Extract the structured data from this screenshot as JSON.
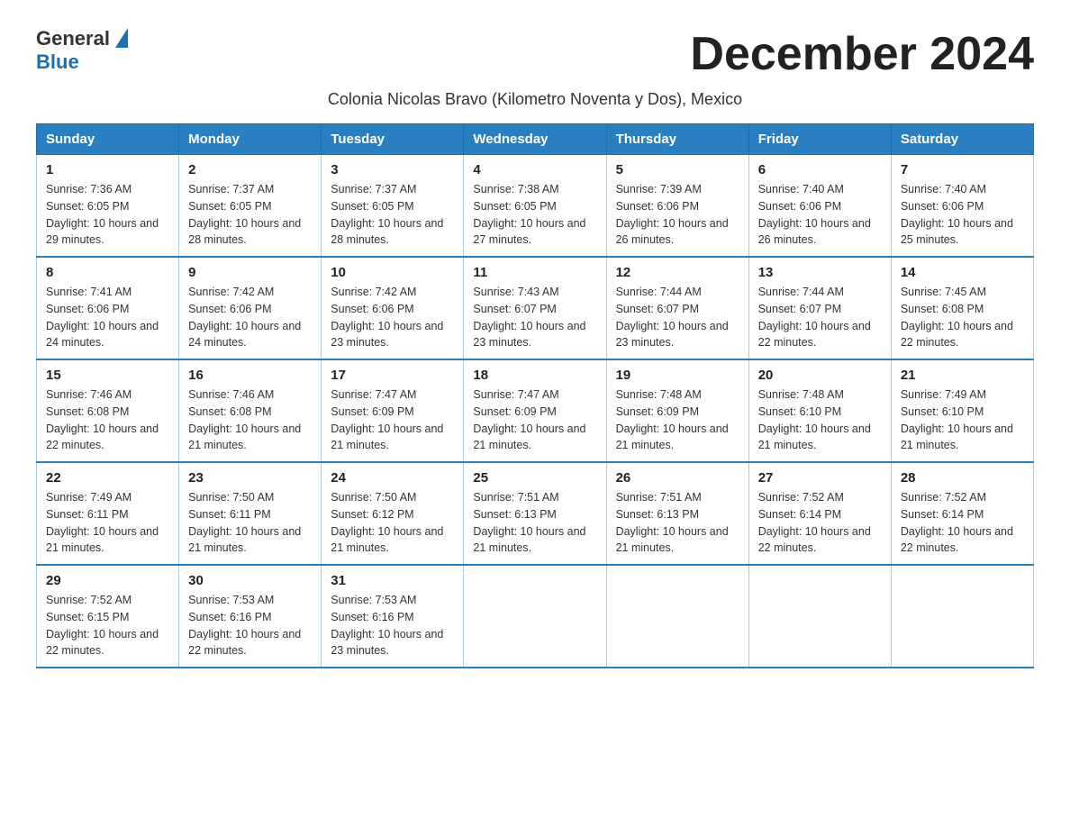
{
  "header": {
    "logo_general": "General",
    "logo_blue": "Blue",
    "month_title": "December 2024",
    "subtitle": "Colonia Nicolas Bravo (Kilometro Noventa y Dos), Mexico"
  },
  "days_of_week": [
    "Sunday",
    "Monday",
    "Tuesday",
    "Wednesday",
    "Thursday",
    "Friday",
    "Saturday"
  ],
  "weeks": [
    [
      {
        "day": "1",
        "sunrise": "7:36 AM",
        "sunset": "6:05 PM",
        "daylight": "10 hours and 29 minutes."
      },
      {
        "day": "2",
        "sunrise": "7:37 AM",
        "sunset": "6:05 PM",
        "daylight": "10 hours and 28 minutes."
      },
      {
        "day": "3",
        "sunrise": "7:37 AM",
        "sunset": "6:05 PM",
        "daylight": "10 hours and 28 minutes."
      },
      {
        "day": "4",
        "sunrise": "7:38 AM",
        "sunset": "6:05 PM",
        "daylight": "10 hours and 27 minutes."
      },
      {
        "day": "5",
        "sunrise": "7:39 AM",
        "sunset": "6:06 PM",
        "daylight": "10 hours and 26 minutes."
      },
      {
        "day": "6",
        "sunrise": "7:40 AM",
        "sunset": "6:06 PM",
        "daylight": "10 hours and 26 minutes."
      },
      {
        "day": "7",
        "sunrise": "7:40 AM",
        "sunset": "6:06 PM",
        "daylight": "10 hours and 25 minutes."
      }
    ],
    [
      {
        "day": "8",
        "sunrise": "7:41 AM",
        "sunset": "6:06 PM",
        "daylight": "10 hours and 24 minutes."
      },
      {
        "day": "9",
        "sunrise": "7:42 AM",
        "sunset": "6:06 PM",
        "daylight": "10 hours and 24 minutes."
      },
      {
        "day": "10",
        "sunrise": "7:42 AM",
        "sunset": "6:06 PM",
        "daylight": "10 hours and 23 minutes."
      },
      {
        "day": "11",
        "sunrise": "7:43 AM",
        "sunset": "6:07 PM",
        "daylight": "10 hours and 23 minutes."
      },
      {
        "day": "12",
        "sunrise": "7:44 AM",
        "sunset": "6:07 PM",
        "daylight": "10 hours and 23 minutes."
      },
      {
        "day": "13",
        "sunrise": "7:44 AM",
        "sunset": "6:07 PM",
        "daylight": "10 hours and 22 minutes."
      },
      {
        "day": "14",
        "sunrise": "7:45 AM",
        "sunset": "6:08 PM",
        "daylight": "10 hours and 22 minutes."
      }
    ],
    [
      {
        "day": "15",
        "sunrise": "7:46 AM",
        "sunset": "6:08 PM",
        "daylight": "10 hours and 22 minutes."
      },
      {
        "day": "16",
        "sunrise": "7:46 AM",
        "sunset": "6:08 PM",
        "daylight": "10 hours and 21 minutes."
      },
      {
        "day": "17",
        "sunrise": "7:47 AM",
        "sunset": "6:09 PM",
        "daylight": "10 hours and 21 minutes."
      },
      {
        "day": "18",
        "sunrise": "7:47 AM",
        "sunset": "6:09 PM",
        "daylight": "10 hours and 21 minutes."
      },
      {
        "day": "19",
        "sunrise": "7:48 AM",
        "sunset": "6:09 PM",
        "daylight": "10 hours and 21 minutes."
      },
      {
        "day": "20",
        "sunrise": "7:48 AM",
        "sunset": "6:10 PM",
        "daylight": "10 hours and 21 minutes."
      },
      {
        "day": "21",
        "sunrise": "7:49 AM",
        "sunset": "6:10 PM",
        "daylight": "10 hours and 21 minutes."
      }
    ],
    [
      {
        "day": "22",
        "sunrise": "7:49 AM",
        "sunset": "6:11 PM",
        "daylight": "10 hours and 21 minutes."
      },
      {
        "day": "23",
        "sunrise": "7:50 AM",
        "sunset": "6:11 PM",
        "daylight": "10 hours and 21 minutes."
      },
      {
        "day": "24",
        "sunrise": "7:50 AM",
        "sunset": "6:12 PM",
        "daylight": "10 hours and 21 minutes."
      },
      {
        "day": "25",
        "sunrise": "7:51 AM",
        "sunset": "6:13 PM",
        "daylight": "10 hours and 21 minutes."
      },
      {
        "day": "26",
        "sunrise": "7:51 AM",
        "sunset": "6:13 PM",
        "daylight": "10 hours and 21 minutes."
      },
      {
        "day": "27",
        "sunrise": "7:52 AM",
        "sunset": "6:14 PM",
        "daylight": "10 hours and 22 minutes."
      },
      {
        "day": "28",
        "sunrise": "7:52 AM",
        "sunset": "6:14 PM",
        "daylight": "10 hours and 22 minutes."
      }
    ],
    [
      {
        "day": "29",
        "sunrise": "7:52 AM",
        "sunset": "6:15 PM",
        "daylight": "10 hours and 22 minutes."
      },
      {
        "day": "30",
        "sunrise": "7:53 AM",
        "sunset": "6:16 PM",
        "daylight": "10 hours and 22 minutes."
      },
      {
        "day": "31",
        "sunrise": "7:53 AM",
        "sunset": "6:16 PM",
        "daylight": "10 hours and 23 minutes."
      },
      null,
      null,
      null,
      null
    ]
  ]
}
